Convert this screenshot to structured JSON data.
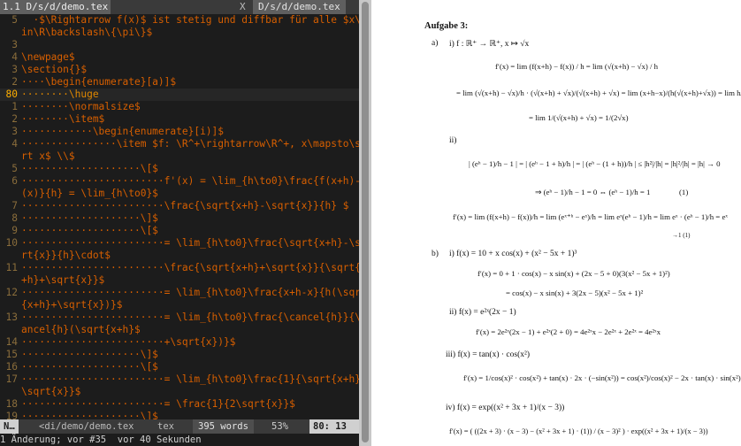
{
  "editor": {
    "tabline": {
      "left_tab": "1.1 D/s/d/demo.tex",
      "close": "X",
      "right_tab": "D/s/d/demo.tex"
    },
    "lines": [
      {
        "num": "5",
        "code": "  ·$\\Rightarrow f(x)$ ist stetig und diffbar für alle $x\\"
      },
      {
        "num": "",
        "code": "in\\R\\backslash\\{\\pi\\}$"
      },
      {
        "num": "3",
        "code": ""
      },
      {
        "num": "4",
        "code": "\\newpage$"
      },
      {
        "num": "3",
        "code": "\\section{}$"
      },
      {
        "num": "2",
        "code": "····\\begin{enumerate}[a)]$"
      },
      {
        "num": "80",
        "code": "········\\huge",
        "cursor": true
      },
      {
        "num": "1",
        "code": "········\\normalsize$"
      },
      {
        "num": "2",
        "code": "········\\item$"
      },
      {
        "num": "3",
        "code": "············\\begin{enumerate}[i)]$"
      },
      {
        "num": "4",
        "code": "················\\item $f: \\R^+\\rightarrow\\R^+, x\\mapsto\\sq"
      },
      {
        "num": "",
        "code": "rt x$ \\\\$"
      },
      {
        "num": "5",
        "code": "····················\\[$"
      },
      {
        "num": "6",
        "code": "························f'(x) = \\lim_{h\\to0}\\frac{f(x+h)-f"
      },
      {
        "num": "",
        "code": "(x)}{h} = \\lim_{h\\to0}$"
      },
      {
        "num": "7",
        "code": "························\\frac{\\sqrt{x+h}-\\sqrt{x}}{h} $"
      },
      {
        "num": "8",
        "code": "····················\\]$"
      },
      {
        "num": "9",
        "code": "····················\\[$"
      },
      {
        "num": "10",
        "code": "························= \\lim_{h\\to0}\\frac{\\sqrt{x+h}-\\sq"
      },
      {
        "num": "",
        "code": "rt{x}}{h}\\cdot$"
      },
      {
        "num": "11",
        "code": "························\\frac{\\sqrt{x+h}+\\sqrt{x}}{\\sqrt{x"
      },
      {
        "num": "",
        "code": "+h}+\\sqrt{x}}$"
      },
      {
        "num": "12",
        "code": "························= \\lim_{h\\to0}\\frac{x+h-x}{h(\\sqrt"
      },
      {
        "num": "",
        "code": "{x+h}+\\sqrt{x})}$"
      },
      {
        "num": "13",
        "code": "························= \\lim_{h\\to0}\\frac{\\cancel{h}}{\\c"
      },
      {
        "num": "",
        "code": "ancel{h}(\\sqrt{x+h}$"
      },
      {
        "num": "14",
        "code": "························+\\sqrt{x})}$"
      },
      {
        "num": "15",
        "code": "····················\\]$"
      },
      {
        "num": "16",
        "code": "····················\\[$"
      },
      {
        "num": "17",
        "code": "························= \\lim_{h\\to0}\\frac{1}{\\sqrt{x+h}+"
      },
      {
        "num": "",
        "code": "\\sqrt{x}}$"
      },
      {
        "num": "18",
        "code": "························= \\frac{1}{2\\sqrt{x}}$"
      },
      {
        "num": "19",
        "code": "····················\\]$"
      }
    ],
    "status": {
      "mode": "N…",
      "file": "<di/demo/demo.tex",
      "filetype": "tex",
      "words": "395 words",
      "percent": "53%",
      "position": "80: 13"
    },
    "cmdline": "1 Änderung; vor #35  vor 40 Sekunden"
  },
  "pdf": {
    "heading": "Aufgabe 3:",
    "a_label": "a)",
    "a_i": "i)  f : ℝ⁺ → ℝ⁺, x ↦ √x",
    "a_eq1": "f′(x) = lim  (f(x+h) − f(x)) / h  = lim  (√(x+h) − √x) / h",
    "a_eq2": "= lim (√(x+h) − √x)/h · (√(x+h) + √x)/(√(x+h) + √x) = lim (x+h−x)/(h(√(x+h)+√x)) = lim h/(h(√(x+h)+√x))",
    "a_eq3": "= lim 1/(√(x+h) + √x) = 1/(2√x)",
    "a_ii": "ii)",
    "a_ii_eq1": "| (eʰ − 1)/h − 1 | = | (eʰ − 1 + h)/h | = | (eʰ − (1 + h))/h | ≤ |h²|/|h| = |h|²/|h| = |h| → 0",
    "a_ii_eq2": "⇒ (eʰ − 1)/h − 1 = 0 ⇔ (eʰ − 1)/h = 1",
    "a_ii_eqno": "(1)",
    "a_ii_eq3": "f′(x) = lim (f(x+h) − f(x))/h = lim (eˣ⁺ʰ − eˣ)/h = lim eˣ(eʰ − 1)/h = lim eˣ · (eʰ − 1)/h = eˣ",
    "a_ii_brace": "→1 (1)",
    "b_label": "b)",
    "b_i": "i)  f(x) = 10 + x cos(x) + (x² − 5x + 1)³",
    "b_i_eq1": "f′(x) = 0 + 1 · cos(x) − x sin(x) + (2x − 5 + 0)(3(x² − 5x + 1)²)",
    "b_i_eq2": "= cos(x) − x sin(x) + 3(2x − 5)(x² − 5x + 1)²",
    "b_ii": "ii)  f(x) = e²ˣ(2x − 1)",
    "b_ii_eq": "f′(x) = 2e²ˣ(2x − 1) + e²ˣ(2 + 0) = 4e²ˣx − 2e²ˣ + 2e²ˣ = 4e²ˣx",
    "b_iii": "iii)  f(x) = tan(x) · cos(x²)",
    "b_iii_eq": "f′(x) = 1/cos(x)² · cos(x²) + tan(x) · 2x · (−sin(x²)) = cos(x²)/cos(x)² − 2x · tan(x) · sin(x²)",
    "b_iv": "iv)  f(x) = exp((x² + 3x + 1)/(x − 3))",
    "b_iv_eq": "f′(x) = ( ((2x + 3) · (x − 3) − (x² + 3x + 1) · (1)) / (x − 3)² ) · exp((x² + 3x + 1)/(x − 3))"
  }
}
